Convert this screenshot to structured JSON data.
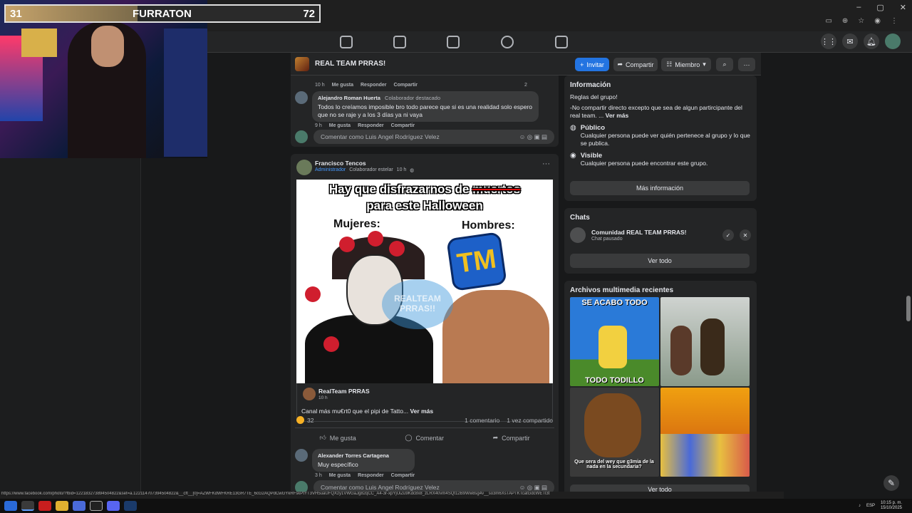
{
  "overlay": {
    "score_left": "31",
    "title": "FURRATON",
    "score_right": "72"
  },
  "group": {
    "name": "REAL TEAM PRRAS!",
    "invite": "Invitar",
    "share": "Compartir",
    "member": "Miembro"
  },
  "comments_top": [
    {
      "name": "Alejandro Roman Huerta",
      "badge": "Colaborador destacado",
      "text": "Todos lo creíamos imposible bro todo parece que si es una realidad solo espero que no se raje y a los 3 días ya ni vaya",
      "time": "9 h"
    }
  ],
  "comment_meta": {
    "time_prev": "10 h",
    "like": "Me gusta",
    "reply": "Responder",
    "share": "Compartir",
    "reactions": "2"
  },
  "comment_placeholder": "Comentar como Luis Angel Rodríguez Velez",
  "post": {
    "author": "Francisco Tencos",
    "role": "Administrador",
    "badge": "Colaborador estelar",
    "time": "10 h",
    "image_line1_a": "Hay que disfrazarnos de ",
    "image_line1_b": "muertos",
    "image_line2": "para este Halloween",
    "label_women": "Mujeres:",
    "label_men": "Hombres:",
    "logo_text": "TM",
    "watermark": "REALTEAM PRRAS!!",
    "shared_author": "RealTeam PRRAS",
    "shared_time": "10 h",
    "shared_text": "Canal más mu€rt0 que el pipi de Tatto...",
    "see_more": "Ver más",
    "reaction_count": "32",
    "comments_count": "1 comentario",
    "shares_count": "1 vez compartido",
    "btn_like": "Me gusta",
    "btn_comment": "Comentar",
    "btn_share": "Compartir"
  },
  "comment_bottom": {
    "name": "Alexander Torres Cartagena",
    "text": "Muy específico",
    "time": "3 h"
  },
  "info": {
    "title": "Información",
    "rules": "Reglas del grupo!",
    "rules_text": "-No compartir directo excepto que sea de algun partircipante del real team. ...",
    "see_more": "Ver más",
    "public_title": "Público",
    "public_text": "Cualquier persona puede ver quién pertenece al grupo y lo que se publica.",
    "visible_title": "Visible",
    "visible_text": "Cualquier persona puede encontrar este grupo.",
    "more_btn": "Más información"
  },
  "chats": {
    "title": "Chats",
    "name": "Comunidad REAL TEAM PRRAS!",
    "status": "Chat pausado",
    "see_all": "Ver todo"
  },
  "media": {
    "title": "Archivos multimedia recientes",
    "m1_top": "SE ACABO TODO",
    "m1_bottom": "TODO TODILLO",
    "m3_text": "Que sera del wey que g3mia de la nada en la secundaria?",
    "see_all": "Ver todo"
  },
  "status_url": "https://www.facebook.com/photo/?fbid=122183273894504822&set=a.122114707394504822&__cft__[0]=AZWFKdWFKRE13GR7TE_6cG2AQPdCwGYkRFskPtYT3VH5uaUFQXzy1VWGaJg82qCC_A4-3r-xpYjUiZu9Kdc8x8_zLRX40vm4SQt12B9Ww8sg4v__so3m6XsTAPTKTcatGdcWETl3t",
  "tray": {
    "lang": "ESP",
    "time": "10:15 p. m.",
    "date": "15/10/2025"
  }
}
